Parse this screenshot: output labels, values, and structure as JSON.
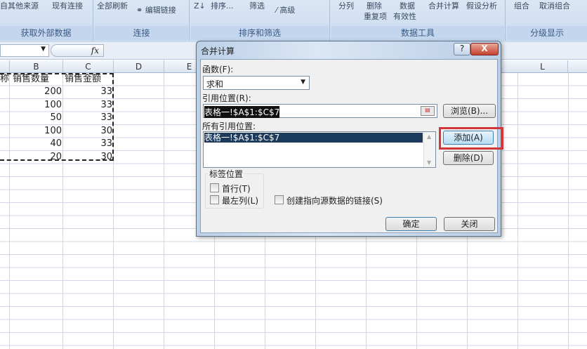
{
  "ribbon": {
    "buttons": [
      "自其他来源",
      "现有连接",
      "全部刷新",
      "编辑链接",
      "排序...",
      "筛选",
      "高级",
      "分列",
      "删除",
      "重复项",
      "数据",
      "有效性",
      "合并计算",
      "假设分析",
      "组合",
      "取消组合"
    ],
    "groups": [
      "获取外部数据",
      "连接",
      "排序和筛选",
      "数据工具",
      "分级显示"
    ]
  },
  "formula_bar": {
    "fx": "fx"
  },
  "columns": [
    "B",
    "C",
    "D",
    "E",
    "L"
  ],
  "sheet": {
    "partial_a_header": "称",
    "headers": [
      "销售数量",
      "销售金额"
    ],
    "rows": [
      [
        "200",
        "33"
      ],
      [
        "100",
        "33"
      ],
      [
        "50",
        "33"
      ],
      [
        "100",
        "30"
      ],
      [
        "40",
        "33"
      ],
      [
        "20",
        "30"
      ]
    ]
  },
  "dialog": {
    "title": "合并计算",
    "help": "?",
    "close": "X",
    "function_label": "函数(F):",
    "function_value": "求和",
    "reference_label": "引用位置(R):",
    "reference_value": "表格一!$A$1:$C$7",
    "browse": "浏览(B)...",
    "all_refs_label": "所有引用位置:",
    "all_refs": [
      "表格一!$A$1:$C$7"
    ],
    "add": "添加(A)",
    "delete": "删除(D)",
    "label_group": "标签位置",
    "top_row": "首行(T)",
    "left_col": "最左列(L)",
    "link": "创建指向源数据的链接(S)",
    "ok": "确定",
    "close_btn": "关闭"
  },
  "colors": {
    "highlight": "#d0363a",
    "selection": "#1c3a5c"
  }
}
